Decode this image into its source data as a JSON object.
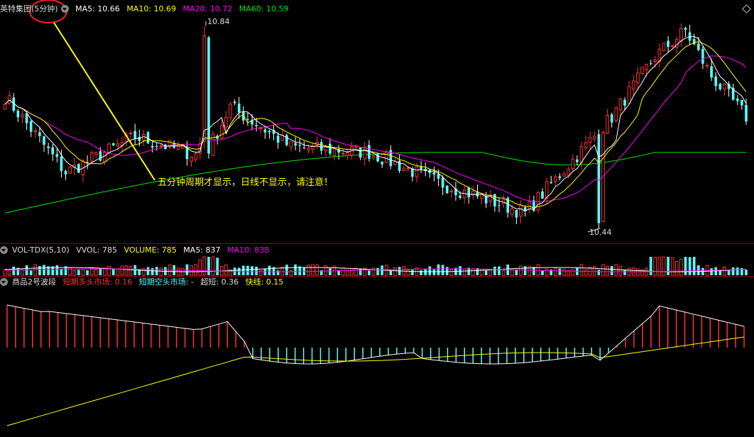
{
  "main_panel": {
    "stock_name": "英特集团",
    "period": "(5分钟)",
    "ma5": "MA5: 10.66",
    "ma10": "MA10: 10.69",
    "ma20": "MA20: 10.72",
    "ma60": "MA60: 10.59",
    "high_label": "10.84",
    "low_label": "10.44",
    "annotation": "五分钟周期才显示，日线不显示，请注意！"
  },
  "vol_panel": {
    "name": "VOL-TDX(5,10)",
    "vvol": "VVOL: 785",
    "volume": "VOLUME: 785",
    "ma5": "MA5: 837",
    "ma10": "MA10: 838"
  },
  "ind_panel": {
    "name": "商品2号波段",
    "bull": "短期多头市场: 0.16",
    "bear": "短期空头市场: -",
    "super_short": "超短: 0.36",
    "fast": "快线: 0.15"
  },
  "colors": {
    "up": "#ff3232",
    "down": "#54ffff",
    "ma5": "#ffffff",
    "ma10": "#ffff00",
    "ma20": "#ff00ff",
    "ma60": "#00e600",
    "grid": "#8b0000",
    "annotation": "#ffff00",
    "circle": "#ff2020"
  },
  "chart_data": [
    {
      "type": "candlestick",
      "title": "英特集团(5分钟)",
      "ylim": [
        10.42,
        10.86
      ],
      "high": 10.84,
      "low": 10.44,
      "key_prices": [
        10.7,
        10.55,
        10.62,
        10.58,
        10.68,
        10.6,
        10.59,
        10.53,
        10.47,
        10.66,
        10.78,
        10.83,
        10.74,
        10.66
      ],
      "series": [
        {
          "name": "MA5",
          "value": 10.66
        },
        {
          "name": "MA10",
          "value": 10.69
        },
        {
          "name": "MA20",
          "value": 10.72
        },
        {
          "name": "MA60",
          "value": 10.59
        }
      ]
    },
    {
      "type": "bar",
      "title": "VOL-TDX(5,10)",
      "series": [
        {
          "name": "VOLUME",
          "value": 785
        },
        {
          "name": "MA5",
          "value": 837
        },
        {
          "name": "MA10",
          "value": 838
        }
      ]
    },
    {
      "type": "bar",
      "title": "商品2号波段",
      "series": [
        {
          "name": "短期多头市场",
          "value": 0.16
        },
        {
          "name": "超短",
          "value": 0.36
        },
        {
          "name": "快线",
          "value": 0.15
        }
      ]
    }
  ]
}
